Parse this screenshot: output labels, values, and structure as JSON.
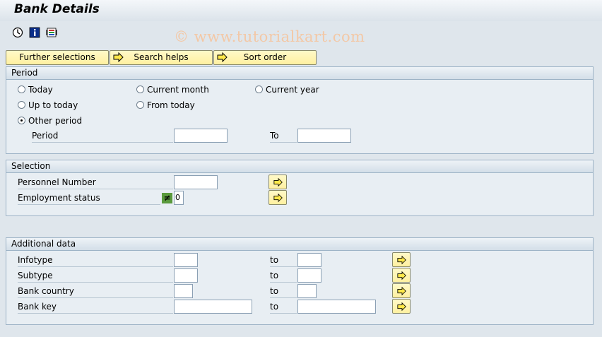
{
  "window": {
    "title": "Bank Details"
  },
  "toolbar": {
    "icons": [
      "execute-icon",
      "info-icon",
      "selection-options-icon"
    ]
  },
  "watermark": "© www.tutorialkart.com",
  "buttons": {
    "further_selections": "Further selections",
    "search_helps": "Search helps",
    "sort_order": "Sort order"
  },
  "period": {
    "heading": "Period",
    "options": {
      "today": "Today",
      "current_month": "Current month",
      "current_year": "Current year",
      "up_to_today": "Up to today",
      "from_today": "From today",
      "other_period": "Other period"
    },
    "selected": "other_period",
    "period_label": "Period",
    "to_label": "To",
    "from_value": "",
    "to_value": ""
  },
  "selection": {
    "heading": "Selection",
    "personnel_number_label": "Personnel Number",
    "personnel_number_value": "",
    "employment_status_label": "Employment status",
    "employment_status_operator": "≠",
    "employment_status_value": "0"
  },
  "additional": {
    "heading": "Additional data",
    "to_label": "to",
    "rows": [
      {
        "label": "Infotype",
        "from": "",
        "to": ""
      },
      {
        "label": "Subtype",
        "from": "",
        "to": ""
      },
      {
        "label": "Bank country",
        "from": "",
        "to": ""
      },
      {
        "label": "Bank key",
        "from": "",
        "to": ""
      }
    ]
  },
  "colors": {
    "background": "#dfe6ec",
    "button_yellow": "#fff0a0",
    "frame_border": "#9db3c6",
    "operator_green": "#5a9a3c"
  }
}
